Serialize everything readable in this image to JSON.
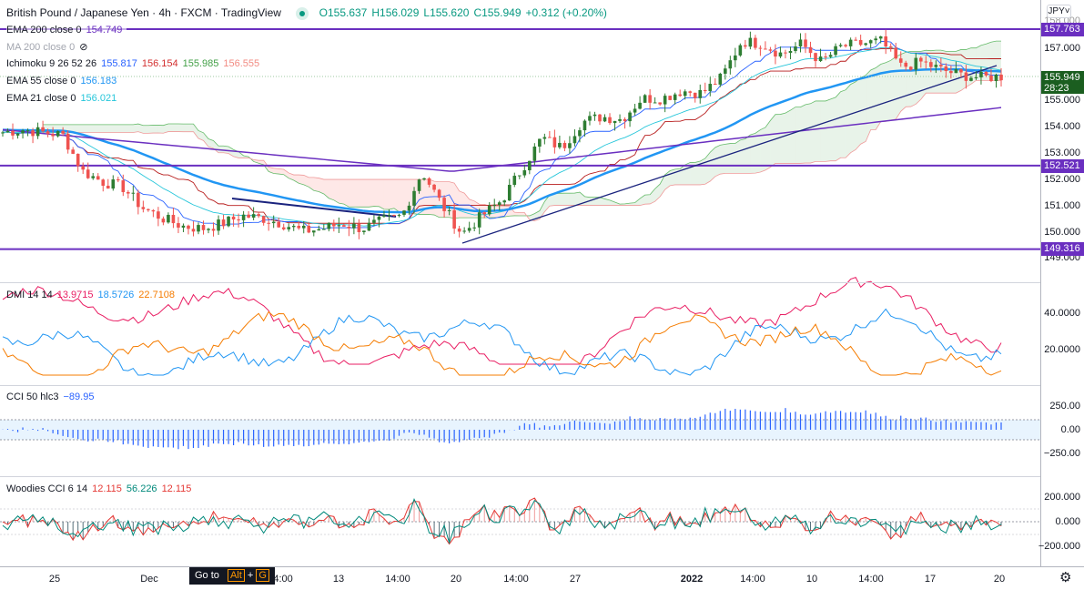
{
  "header": {
    "title": "British Pound / Japanese Yen · 4h · FXCM · TradingView",
    "open": "O155.637",
    "high": "H156.029",
    "low": "L155.620",
    "close": "C155.949",
    "change": "+0.312 (+0.20%)"
  },
  "legends": {
    "ema200": {
      "label": "EMA 200 close 0",
      "value": "154.749"
    },
    "ma200": {
      "label": "MA 200 close 0"
    },
    "ichimoku": {
      "label": "Ichimoku 9 26 52 26",
      "v1": "155.817",
      "v2": "156.154",
      "v3": "155.985",
      "v4": "156.555"
    },
    "ema55": {
      "label": "EMA 55 close 0",
      "value": "156.183"
    },
    "ema21": {
      "label": "EMA 21 close 0",
      "value": "156.021"
    },
    "dmi": {
      "label": "DMI 14 14",
      "v1": "13.9715",
      "v2": "18.5726",
      "v3": "22.7108"
    },
    "cci": {
      "label": "CCI 50 hlc3",
      "value": "−89.95"
    },
    "woodies": {
      "label": "Woodies CCI 6 14",
      "v1": "12.115",
      "v2": "56.226",
      "v3": "12.115"
    }
  },
  "currency": "JPY",
  "price_axis": [
    "158.000",
    "157.000",
    "155.000",
    "154.000",
    "153.000",
    "152.000",
    "151.000",
    "150.000",
    "149.000"
  ],
  "price_lines": [
    "157.763",
    "152.521",
    "149.316"
  ],
  "last_price": {
    "value": "155.949",
    "countdown": "28:23"
  },
  "dmi_axis": [
    "40.0000",
    "20.0000"
  ],
  "cci_axis": [
    "250.00",
    "0.00",
    "−250.00"
  ],
  "woodies_axis": [
    "200.000",
    "0.000",
    "−200.000"
  ],
  "time_axis": [
    "25",
    "Dec",
    "14:00",
    "13",
    "14:00",
    "20",
    "14:00",
    "27",
    "2022",
    "14:00",
    "10",
    "14:00",
    "17",
    "20"
  ],
  "tooltip": {
    "text": "Go to",
    "key1": "Alt",
    "plus": "+",
    "key2": "G"
  },
  "colors": {
    "up": "#2e7d32",
    "down": "#ef5350",
    "ema200": "#6a2fc0",
    "ema55": "#2196f3",
    "ema21": "#26c6da",
    "level": "#6a2fc0"
  },
  "chart_data": {
    "type": "candlestick",
    "closes": [
      153.8,
      153.9,
      153.8,
      153.7,
      152.3,
      151.9,
      151.7,
      150.9,
      150.5,
      150.2,
      150.1,
      150.3,
      150.6,
      150.5,
      150.3,
      150.0,
      150.1,
      150.3,
      150.1,
      150.4,
      150.6,
      152.3,
      151.0,
      149.9,
      150.6,
      151.2,
      152.4,
      153.6,
      153.2,
      154.2,
      154.4,
      154.3,
      155.1,
      155.1,
      155.4,
      155.3,
      155.9,
      157.3,
      157.2,
      156.8,
      157.2,
      156.5,
      157.1,
      157.2,
      157.3,
      156.3,
      156.5,
      156.2,
      156.0,
      155.9,
      155.95
    ],
    "levels": [
      157.763,
      152.521,
      149.316
    ],
    "ylim": [
      148.8,
      158.3
    ]
  }
}
